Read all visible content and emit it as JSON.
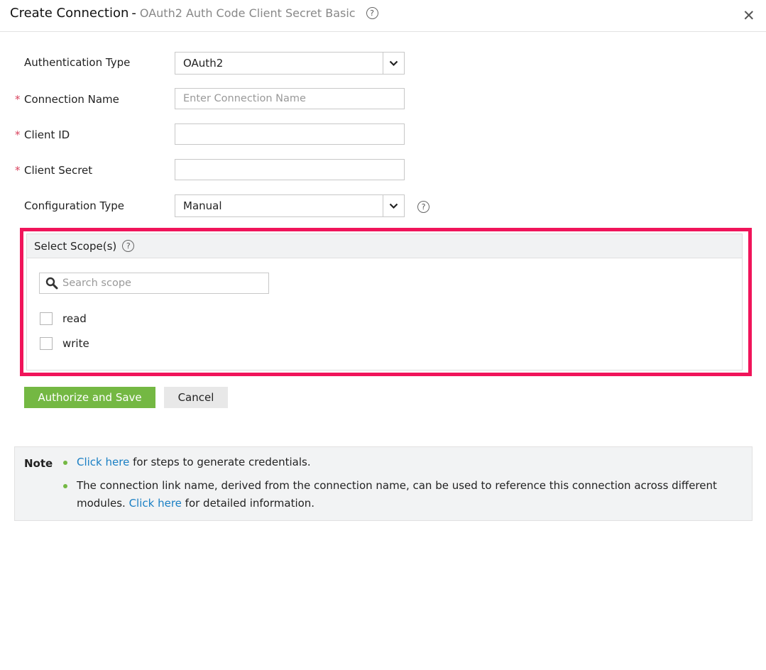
{
  "header": {
    "title": "Create Connection",
    "separator": "-",
    "subtitle": "OAuth2 Auth Code Client Secret Basic",
    "help_glyph": "?",
    "close_glyph": "✕"
  },
  "form": {
    "auth_type": {
      "label": "Authentication Type",
      "value": "OAuth2"
    },
    "connection_name": {
      "label": "Connection Name",
      "required_mark": "*",
      "placeholder": "Enter Connection Name",
      "value": ""
    },
    "client_id": {
      "label": "Client ID",
      "required_mark": "*",
      "value": ""
    },
    "client_secret": {
      "label": "Client Secret",
      "required_mark": "*",
      "value": ""
    },
    "config_type": {
      "label": "Configuration Type",
      "value": "Manual"
    }
  },
  "scopes": {
    "title": "Select Scope(s)",
    "search_placeholder": "Search scope",
    "items": [
      {
        "label": "read",
        "checked": false
      },
      {
        "label": "write",
        "checked": false
      }
    ],
    "highlight_color": "#f0145a"
  },
  "actions": {
    "authorize_label": "Authorize and Save",
    "cancel_label": "Cancel",
    "primary_color": "#74b843"
  },
  "note": {
    "title": "Note",
    "item1_link": "Click here",
    "item1_text": " for steps to generate credentials.",
    "item2_text_a": "The connection link name, derived from the connection name, can be used to reference this connection across different modules. ",
    "item2_link": "Click here",
    "item2_text_b": " for detailed information.",
    "link_color": "#1a7fc4"
  }
}
